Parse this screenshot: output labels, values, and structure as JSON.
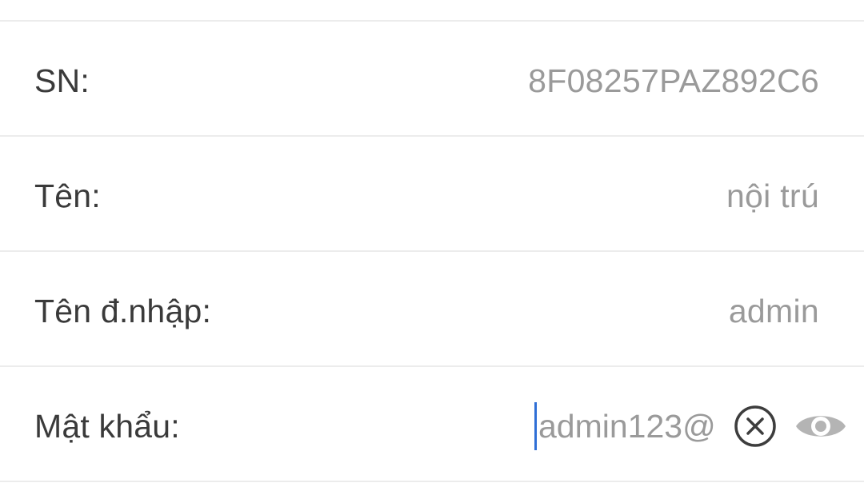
{
  "device": {
    "sn_label": "SN:",
    "sn_value": "8F08257PAZ892C6",
    "name_label": "Tên:",
    "name_value": "nội trú",
    "username_label": "Tên đ.nhập:",
    "username_value": "admin",
    "password_label": "Mật khẩu:",
    "password_value": "admin123@"
  },
  "icons": {
    "clear": "clear-circle-x-icon",
    "visibility": "eye-icon"
  },
  "colors": {
    "label": "#3a3a3a",
    "value": "#9a9a9a",
    "divider": "#ececec",
    "cursor": "#2f6fd6",
    "clear_icon": "#3d3d3d",
    "eye_icon": "#b4b4b4"
  }
}
